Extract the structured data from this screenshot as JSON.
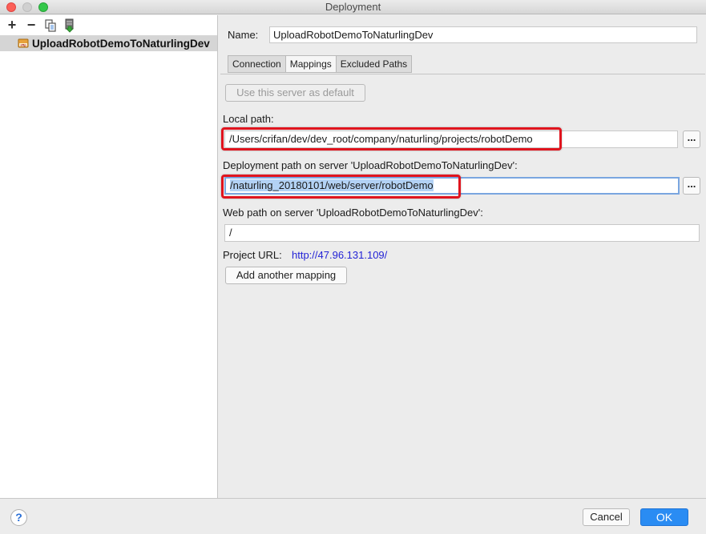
{
  "window": {
    "title": "Deployment"
  },
  "sidebar": {
    "toolbar": {
      "add": "+",
      "remove": "−"
    },
    "servers": [
      {
        "name": "UploadRobotDemoToNaturlingDev",
        "icon": "sftp-icon"
      }
    ]
  },
  "form": {
    "name_label": "Name:",
    "name_value": "UploadRobotDemoToNaturlingDev"
  },
  "tabs": [
    {
      "label": "Connection",
      "active": false
    },
    {
      "label": "Mappings",
      "active": true
    },
    {
      "label": "Excluded Paths",
      "active": false
    }
  ],
  "mappings": {
    "default_button": "Use this server as default",
    "local_path_label": "Local path:",
    "local_path_value": "/Users/crifan/dev/dev_root/company/naturling/projects/robotDemo",
    "deploy_path_label": "Deployment path on server 'UploadRobotDemoToNaturlingDev':",
    "deploy_path_value": "/naturling_20180101/web/server/robotDemo",
    "web_path_label": "Web path on server 'UploadRobotDemoToNaturlingDev':",
    "web_path_value": "/",
    "project_url_label": "Project URL:",
    "project_url_value": "http://47.96.131.109/",
    "add_mapping_button": "Add another mapping",
    "browse_label": "..."
  },
  "footer": {
    "help": "?",
    "cancel": "Cancel",
    "ok": "OK"
  },
  "colors": {
    "accent": "#2a8cf3",
    "highlight": "#e0141e",
    "selection": "#b3d2f5",
    "link": "#2323d6"
  }
}
